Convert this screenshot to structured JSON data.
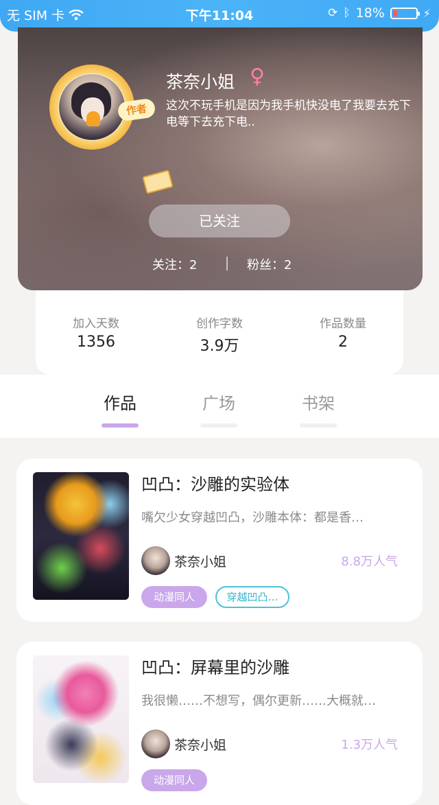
{
  "status_bar": {
    "carrier": "无 SIM 卡",
    "time": "下午11:04",
    "battery": "18%",
    "battery_level": 0.18
  },
  "profile": {
    "username": "茶奈小姐",
    "gender_icon": "female-icon",
    "badge": "作者",
    "bio": "这次不玩手机是因为我手机快没电了我要去充下电等下去充下电..",
    "follow_button": "已关注",
    "following": "关注：2",
    "fans": "粉丝：2"
  },
  "stats": [
    {
      "label": "加入天数",
      "value": "1356"
    },
    {
      "label": "创作字数",
      "value": "3.9万"
    },
    {
      "label": "作品数量",
      "value": "2"
    }
  ],
  "tabs": [
    {
      "label": "作品",
      "active": true
    },
    {
      "label": "广场",
      "active": false
    },
    {
      "label": "书架",
      "active": false
    }
  ],
  "books": [
    {
      "title": "凹凸：沙雕的实验体",
      "description": "嘴欠少女穿越凹凸，沙雕本体：都是香…",
      "author": "茶奈小姐",
      "popularity": "8.8万人气",
      "tags": [
        "动漫同人",
        "穿越凹凸…"
      ]
    },
    {
      "title": "凹凸：屏幕里的沙雕",
      "description": "我很懒……不想写，偶尔更新……大概就…",
      "author": "茶奈小姐",
      "popularity": "1.3万人气",
      "tags": [
        "动漫同人"
      ]
    }
  ],
  "colors": {
    "accent": "#c9a7ea",
    "status_bar": "#42acf5",
    "tag_outline": "#4cc1d8"
  }
}
